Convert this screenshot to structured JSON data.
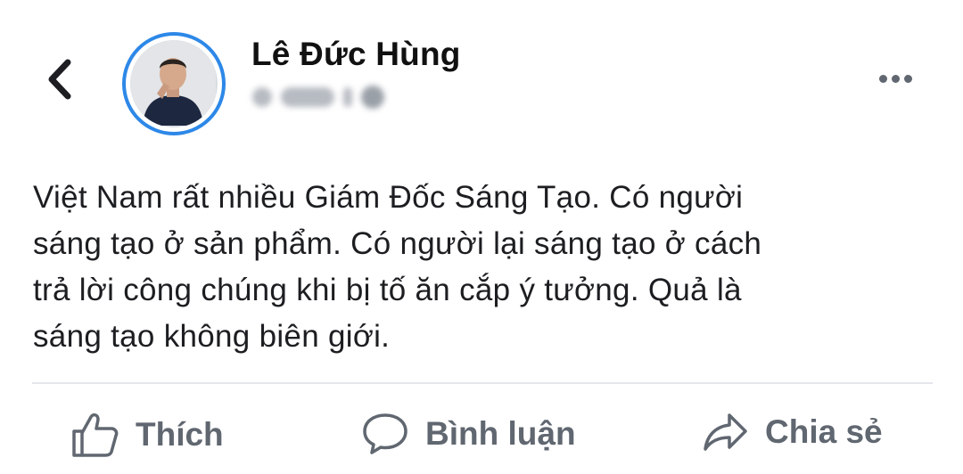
{
  "post": {
    "author": "Lê Đức Hùng",
    "text_lines": [
      "Việt Nam rất nhiều Giám Đốc Sáng Tạo. Có người",
      "sáng tạo ở sản phẩm. Có người lại sáng tạo ở cách",
      "trả lời công chúng khi bị tố ăn cắp ý tưởng. Quả là",
      "sáng tạo không biên giới."
    ]
  },
  "actions": {
    "like": "Thích",
    "comment": "Bình luận",
    "share": "Chia sẻ"
  },
  "icons": {
    "back": "chevron-left-icon",
    "more": "more-horizontal-icon",
    "like": "thumbs-up-icon",
    "comment": "comment-bubble-icon",
    "share": "share-arrow-icon"
  },
  "colors": {
    "avatar_ring": "#2d88e8",
    "action_text": "#606770",
    "body_text": "#1c1e21"
  }
}
